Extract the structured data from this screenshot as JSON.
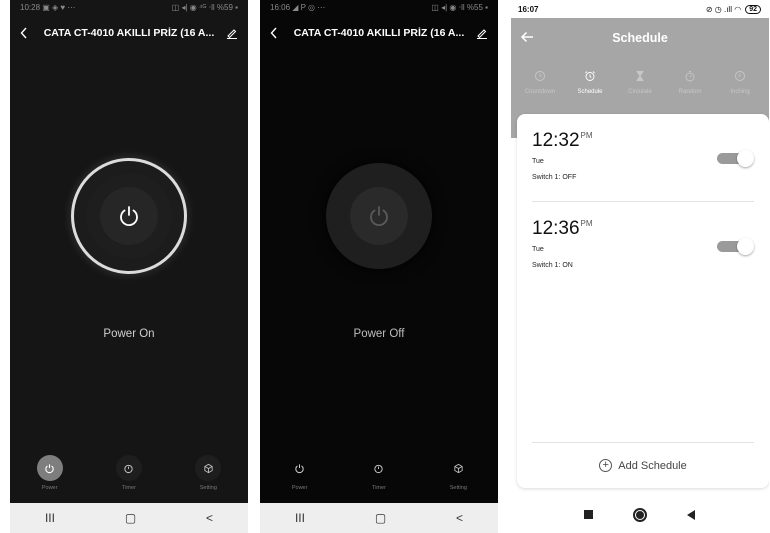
{
  "phone1": {
    "status": {
      "time": "10:28",
      "left_icons": "▣ ◈ ♥ ⋯",
      "right_icons": "◫ ◂| ◉ ⁴ᴳ ⋅ll",
      "battery": "%59 ▪"
    },
    "title": "CATA CT-4010 AKILLI PRİZ (16 A...",
    "power_label": "Power On",
    "nav": [
      {
        "label": "Power"
      },
      {
        "label": "Timer"
      },
      {
        "label": "Setting"
      }
    ],
    "sysnav": {
      "recent": "III",
      "home": "▢",
      "back": "<"
    }
  },
  "phone2": {
    "status": {
      "time": "16:06",
      "left_icons": "◢ P ◎ ⋯",
      "right_icons": "◫ ◂| ◉ ⋅ll",
      "battery": "%55 ▪"
    },
    "title": "CATA CT-4010 AKILLI PRİZ (16 A...",
    "power_label": "Power Off",
    "nav": [
      {
        "label": "Power"
      },
      {
        "label": "Timer"
      },
      {
        "label": "Setting"
      }
    ],
    "sysnav": {
      "recent": "III",
      "home": "▢",
      "back": "<"
    }
  },
  "phone3": {
    "status": {
      "time": "16:07",
      "right_icons": "⊘ ◷ .ıll ◠",
      "battery": "92"
    },
    "title": "Schedule",
    "tabs": [
      {
        "label": "Countdown"
      },
      {
        "label": "Schedule"
      },
      {
        "label": "Circulate"
      },
      {
        "label": "Random"
      },
      {
        "label": "Inching"
      }
    ],
    "schedules": [
      {
        "time": "12:32",
        "ampm": "PM",
        "day": "Tue",
        "action": "Switch 1: OFF",
        "enabled": true
      },
      {
        "time": "12:36",
        "ampm": "PM",
        "day": "Tue",
        "action": "Switch 1: ON",
        "enabled": true
      }
    ],
    "add_label": "Add Schedule"
  },
  "colors": {
    "accent": "#a6a6a6",
    "dark_bg": "#151515",
    "power_on_ring": "#d9d9d9"
  }
}
